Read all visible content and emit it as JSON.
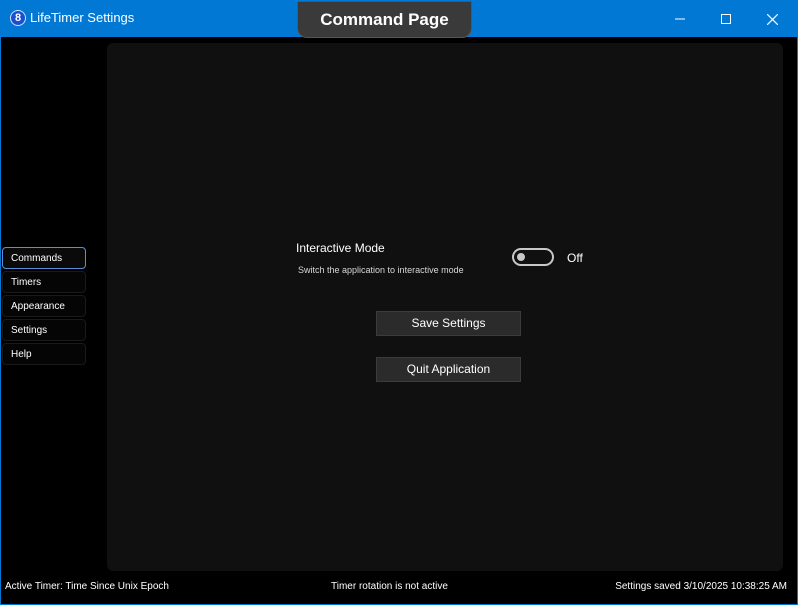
{
  "window": {
    "title": "LifeTimer Settings",
    "page_title": "Command Page",
    "icon": "lifetimer-app-icon",
    "accent_color": "#0078d4",
    "controls": {
      "minimize_icon": "minimize-icon",
      "maximize_icon": "maximize-icon",
      "close_icon": "close-icon"
    }
  },
  "nav": {
    "items": [
      {
        "label": "Commands",
        "active": true
      },
      {
        "label": "Timers"
      },
      {
        "label": "Appearance"
      },
      {
        "label": "Settings"
      },
      {
        "label": "Help"
      }
    ]
  },
  "commands": {
    "interactive_mode": {
      "title": "Interactive Mode",
      "description": "Switch the application to interactive mode",
      "state_label": "Off",
      "on": false
    },
    "save_button": "Save Settings",
    "quit_button": "Quit Application"
  },
  "status_bar": {
    "active_timer": "Active Timer: Time Since Unix Epoch",
    "rotation": "Timer rotation is not active",
    "saved": "Settings saved 3/10/2025 10:38:25 AM"
  }
}
